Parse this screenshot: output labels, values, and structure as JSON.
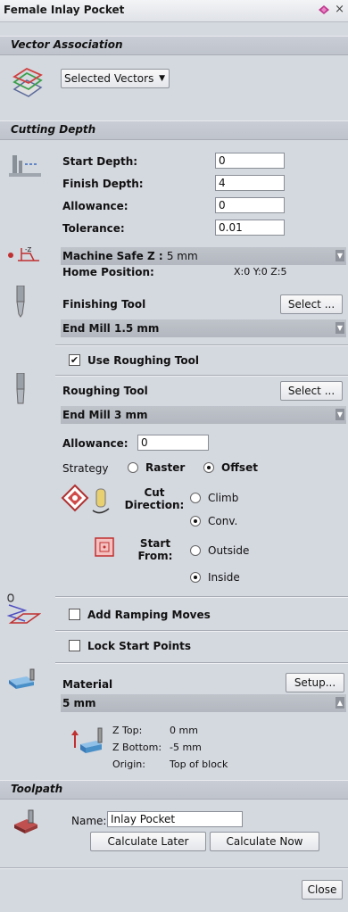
{
  "window": {
    "title": "Female Inlay Pocket",
    "close_glyph": "×"
  },
  "vector_association": {
    "heading": "Vector Association",
    "selector_label": "Selected Vectors"
  },
  "cutting_depth": {
    "heading": "Cutting Depth",
    "start_depth_label": "Start Depth:",
    "start_depth_value": "0",
    "finish_depth_label": "Finish Depth:",
    "finish_depth_value": "4",
    "allowance_label": "Allowance:",
    "allowance_value": "0",
    "tolerance_label": "Tolerance:",
    "tolerance_value": "0.01"
  },
  "machine": {
    "safe_z_label": "Machine Safe Z :",
    "safe_z_value": "5 mm",
    "home_label": "Home Position:",
    "home_value": "X:0 Y:0 Z:5"
  },
  "finishing_tool": {
    "label": "Finishing Tool",
    "select_button": "Select ...",
    "tool_name": "End Mill 1.5 mm"
  },
  "roughing": {
    "use_label": "Use Roughing Tool",
    "use_checked": true,
    "label": "Roughing Tool",
    "select_button": "Select ...",
    "tool_name": "End Mill 3 mm",
    "allowance_label": "Allowance:",
    "allowance_value": "0",
    "strategy_label": "Strategy",
    "raster_label": "Raster",
    "offset_label": "Offset",
    "strategy_selected": "Offset",
    "cut_direction_label": "Cut Direction:",
    "climb_label": "Climb",
    "conv_label": "Conv.",
    "cut_direction_selected": "Conv.",
    "start_from_label": "Start From:",
    "outside_label": "Outside",
    "inside_label": "Inside",
    "start_from_selected": "Inside"
  },
  "ramping": {
    "label": "Add Ramping Moves",
    "checked": false
  },
  "lock_start": {
    "label": "Lock Start Points",
    "checked": false
  },
  "material": {
    "label": "Material",
    "setup_button": "Setup...",
    "thickness": "5 mm",
    "z_top_label": "Z Top:",
    "z_top_value": "0 mm",
    "z_bottom_label": "Z Bottom:",
    "z_bottom_value": "-5 mm",
    "origin_label": "Origin:",
    "origin_value": "Top of block"
  },
  "toolpath": {
    "heading": "Toolpath",
    "name_label": "Name:",
    "name_value": "Inlay Pocket",
    "calculate_later": "Calculate Later",
    "calculate_now": "Calculate Now"
  },
  "footer": {
    "close_button": "Close"
  },
  "colors": {
    "panel": "#d4d8df",
    "section": "#c4c9d1",
    "bar": "#b8bdc5",
    "radio_icon": "#c0392b",
    "material_icon": "#4a90c8"
  }
}
